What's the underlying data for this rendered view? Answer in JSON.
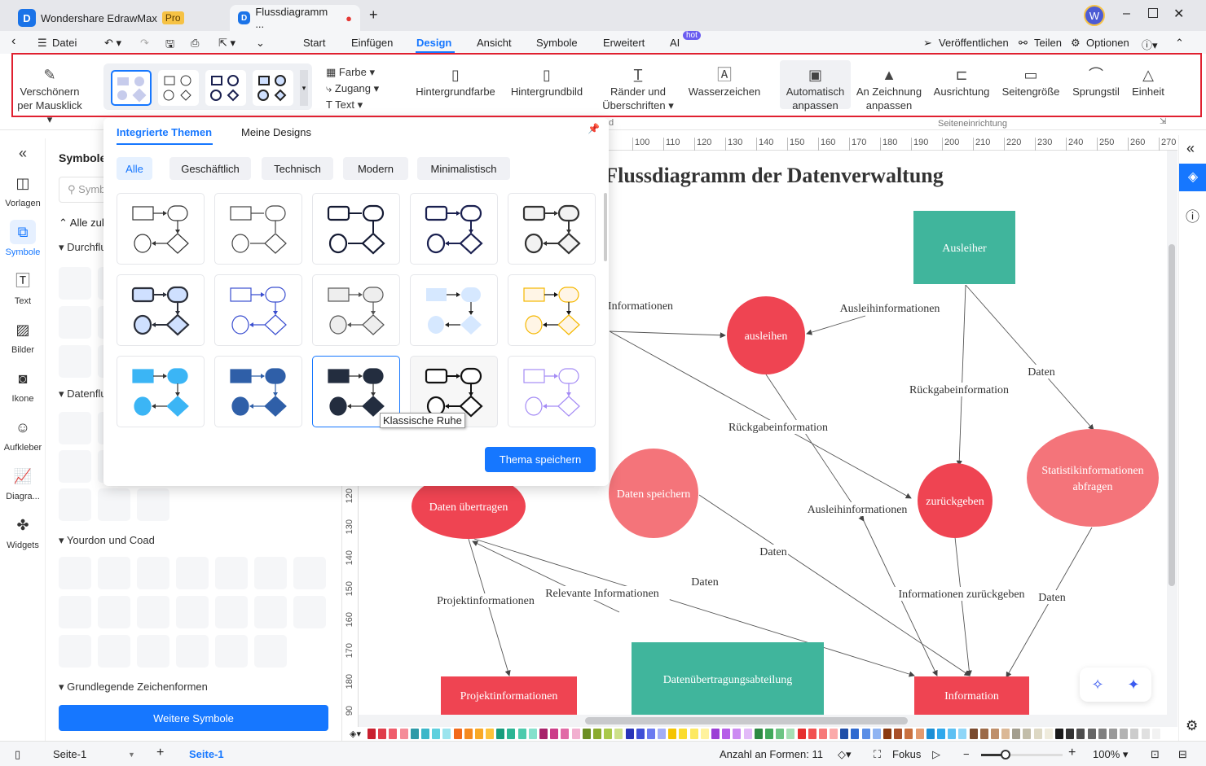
{
  "app": {
    "name": "Wondershare EdrawMax",
    "badge": "Pro",
    "doc_tab": "Flussdiagramm ...",
    "avatar": "W"
  },
  "menu": {
    "back": "‹",
    "file": "Datei",
    "items": [
      "Start",
      "Einfügen",
      "Design",
      "Ansicht",
      "Symbole",
      "Erweitert",
      "AI"
    ],
    "active": "Design",
    "ai_badge": "hot",
    "publish": "Veröffentlichen",
    "share": "Teilen",
    "options": "Optionen"
  },
  "ribbon": {
    "beautify": "Verschönern per Mausklick",
    "style_opts": [
      "Farbe",
      "Zugang",
      "Text"
    ],
    "bg_color": "Hintergrundfarbe",
    "bg_image": "Hintergrundbild",
    "borders": "Ränder und Überschriften",
    "watermark": "Wasserzeichen",
    "auto_fit": "Automatisch anpassen",
    "fit_drawing": "An Zeichnung anpassen",
    "orientation": "Ausrichtung",
    "page_size": "Seitengröße",
    "jump_style": "Sprungstil",
    "unit": "Einheit",
    "group_partial": "d",
    "group_page_setup": "Seiteneinrichtung"
  },
  "leftbar": {
    "items": [
      {
        "label": "Vorlagen",
        "icon": "template-icon"
      },
      {
        "label": "Symbole",
        "icon": "symbols-icon",
        "active": true
      },
      {
        "label": "Text",
        "icon": "text-icon"
      },
      {
        "label": "Bilder",
        "icon": "image-icon"
      },
      {
        "label": "Ikone",
        "icon": "icon-icon"
      },
      {
        "label": "Aufkleber",
        "icon": "sticker-icon"
      },
      {
        "label": "Diagra...",
        "icon": "chart-icon"
      },
      {
        "label": "Widgets",
        "icon": "widget-icon"
      }
    ]
  },
  "symbols": {
    "title": "Symbole",
    "search_placeholder": "Symbole suchen",
    "collapse_all": "Alle zuklappen",
    "sections": [
      "Durchflussdiagramm",
      "Datenflussdiagramm",
      "Yourdon und Coad",
      "Grundlegende Zeichenformen"
    ],
    "more_button": "Weitere Symbole"
  },
  "themes": {
    "tabs": [
      "Integrierte Themen",
      "Meine Designs"
    ],
    "filters": [
      "Alle",
      "Geschäftlich",
      "Technisch",
      "Modern",
      "Minimalistisch"
    ],
    "tooltip": "Klassische Ruhe",
    "save_button": "Thema speichern",
    "cards": [
      {
        "stroke": "#333333",
        "fill": "#ffffff",
        "arrow": true
      },
      {
        "stroke": "#444444",
        "fill": "#ffffff",
        "arrow": false
      },
      {
        "stroke": "#141a33",
        "fill": "#ffffff",
        "arrow": false,
        "bold": true
      },
      {
        "stroke": "#1a2050",
        "fill": "#ffffff",
        "arrow": true,
        "bold": true
      },
      {
        "stroke": "#333333",
        "fill": "#f2f2f2",
        "arrow": true,
        "bold": true
      },
      {
        "stroke": "#2b2f3a",
        "fill": "#cfe0ff",
        "arrow": true,
        "bold": true
      },
      {
        "stroke": "#3b4fd0",
        "fill": "#ffffff",
        "arrow": true
      },
      {
        "stroke": "#555555",
        "fill": "#eeeeee",
        "arrow": true
      },
      {
        "stroke": "#222222",
        "fill": "#d6e8ff",
        "arrow": true,
        "nostroke": true
      },
      {
        "stroke": "#f5b800",
        "fill": "#fff5e6",
        "arrow": true,
        "line": "#111111"
      },
      {
        "stroke": "#3bb5f5",
        "fill": "#3bb5f5",
        "arrow": true,
        "line": "#333333"
      },
      {
        "stroke": "#2f5fa8",
        "fill": "#2f5fa8",
        "arrow": true,
        "line": "#2f5fa8"
      },
      {
        "stroke": "#232d3f",
        "fill": "#232d3f",
        "arrow": true,
        "line": "#333333"
      },
      {
        "stroke": "#111111",
        "fill": "#ffffff",
        "arrow": true,
        "bold": true
      },
      {
        "stroke": "#a58cf5",
        "fill": "#ffffff",
        "arrow": true
      }
    ],
    "selected": 12
  },
  "ruler": {
    "top": [
      "100",
      "110",
      "120",
      "130",
      "140",
      "150",
      "160",
      "170",
      "180",
      "190",
      "200",
      "210",
      "220",
      "230",
      "240",
      "250",
      "260",
      "270"
    ],
    "left": [
      "120",
      "130",
      "140",
      "150",
      "160",
      "170",
      "180",
      "90"
    ]
  },
  "diagram": {
    "title": "Flussdiagramm der Datenverwaltung",
    "colors": {
      "red": "#ef4452",
      "light_red": "#f4747a",
      "teal": "#40b59c"
    },
    "nodes": [
      {
        "label": "Ausleiher",
        "color": "teal"
      },
      {
        "label": "ausleihen",
        "color": "red"
      },
      {
        "label": "zurückgeben",
        "color": "red"
      },
      {
        "label": "Statistikinformationen abfragen",
        "color": "light_red"
      },
      {
        "label": "Daten speichern",
        "color": "light_red"
      },
      {
        "label": "Daten übertragen",
        "color": "red"
      },
      {
        "label": "Projektinformationen",
        "color": "red"
      },
      {
        "label": "Datenübertragungsabteilung",
        "color": "teal"
      },
      {
        "label": "Information",
        "color": "red"
      }
    ],
    "edge_labels": [
      "Informationen",
      "Ausleihinformationen",
      "Daten",
      "Rückgabeinformation",
      "Rückgabeinformation",
      "Ausleihinformationen",
      "Daten",
      "Daten",
      "Relevante Informationen",
      "Projektinformationen",
      "Informationen zurückgeben",
      "Daten"
    ]
  },
  "palette": [
    "#c9202f",
    "#e03c4a",
    "#ef5c6b",
    "#f58c98",
    "#2d9aa8",
    "#3bb7c9",
    "#5fd0de",
    "#9be4ee",
    "#f26a1b",
    "#f5891f",
    "#f9a825",
    "#fdc23a",
    "#179c7d",
    "#2bb594",
    "#4ccbad",
    "#85e0cc",
    "#a8226b",
    "#cc3d89",
    "#e16aa6",
    "#f2b0d0",
    "#6b8e23",
    "#8bab2e",
    "#a9c94a",
    "#cde08a",
    "#2a35b8",
    "#3f4fd6",
    "#6b7af0",
    "#a3adf7",
    "#f5c400",
    "#fbdc2e",
    "#fde961",
    "#fff29d",
    "#9b3fd6",
    "#b65ee8",
    "#cc8af2",
    "#e2baf8",
    "#2d8a43",
    "#40a85a",
    "#6cc483",
    "#a6dfb4",
    "#e62e2e",
    "#f25050",
    "#f77878",
    "#fbaaaa",
    "#1f4ea8",
    "#2f6ad0",
    "#5a8ee6",
    "#8fb4f2",
    "#8a3a12",
    "#a8502a",
    "#c9703f",
    "#e39a6e",
    "#1b8fd6",
    "#2fa8ec",
    "#5cc0f3",
    "#8fd6f8",
    "#7a4a2e",
    "#9c6a48",
    "#bf8f6a",
    "#dbb896",
    "#a39e8e",
    "#c2bda9",
    "#ddd8c4",
    "#efebdc",
    "#1a1a1a",
    "#333333",
    "#4d4d4d",
    "#666666",
    "#808080",
    "#999999",
    "#b3b3b3",
    "#cccccc",
    "#e0e0e0",
    "#f2f2f2"
  ],
  "status": {
    "page_select": "Seite-1",
    "page_tab": "Seite-1",
    "shape_count": "Anzahl an Formen: 11",
    "focus": "Fokus",
    "zoom": "100%",
    "zoom_fraction": 0.3
  }
}
